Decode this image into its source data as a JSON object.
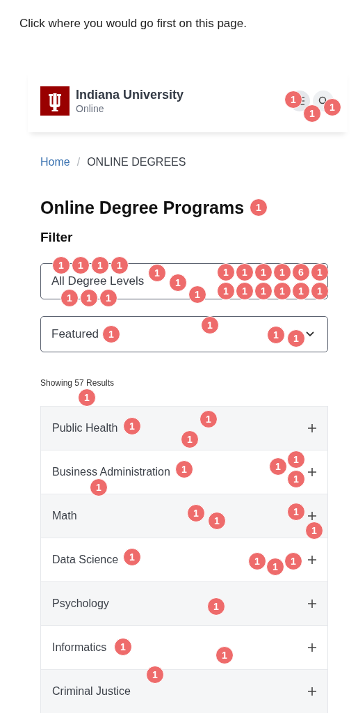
{
  "prompt": "Click where you would go first on this page.",
  "header": {
    "title": "Indiana University",
    "subtitle": "Online"
  },
  "breadcrumb": [
    {
      "label": "Home",
      "kind": "link"
    },
    {
      "label": "/",
      "kind": "separator"
    },
    {
      "label": "ONLINE DEGREES",
      "kind": "current"
    }
  ],
  "page_title": "Online Degree Programs",
  "filter_heading": "Filter",
  "filters": [
    {
      "value": "All Degree Levels",
      "arrow_shown": false
    },
    {
      "value": "Featured",
      "arrow_shown": true
    }
  ],
  "results_count": "Showing 57 Results",
  "programs": [
    {
      "label": "Public Health"
    },
    {
      "label": "Business Administration"
    },
    {
      "label": "Math"
    },
    {
      "label": "Data Science"
    },
    {
      "label": "Psychology"
    },
    {
      "label": "Informatics"
    },
    {
      "label": "Criminal Justice"
    }
  ],
  "click_markers": [
    "1",
    "1",
    "1",
    "1",
    "1",
    "1",
    "1",
    "1",
    "1",
    "1",
    "1",
    "1",
    "1",
    "1",
    "1",
    "1",
    "1",
    "1",
    "6",
    "1",
    "1",
    "1",
    "1",
    "1",
    "1",
    "1",
    "1",
    "1",
    "1",
    "1",
    "1",
    "1",
    "1",
    "1",
    "1",
    "1",
    "1",
    "1",
    "1",
    "1",
    "1",
    "1",
    "1",
    "1",
    "1",
    "1",
    "1",
    "1",
    "1",
    "1",
    "1"
  ]
}
